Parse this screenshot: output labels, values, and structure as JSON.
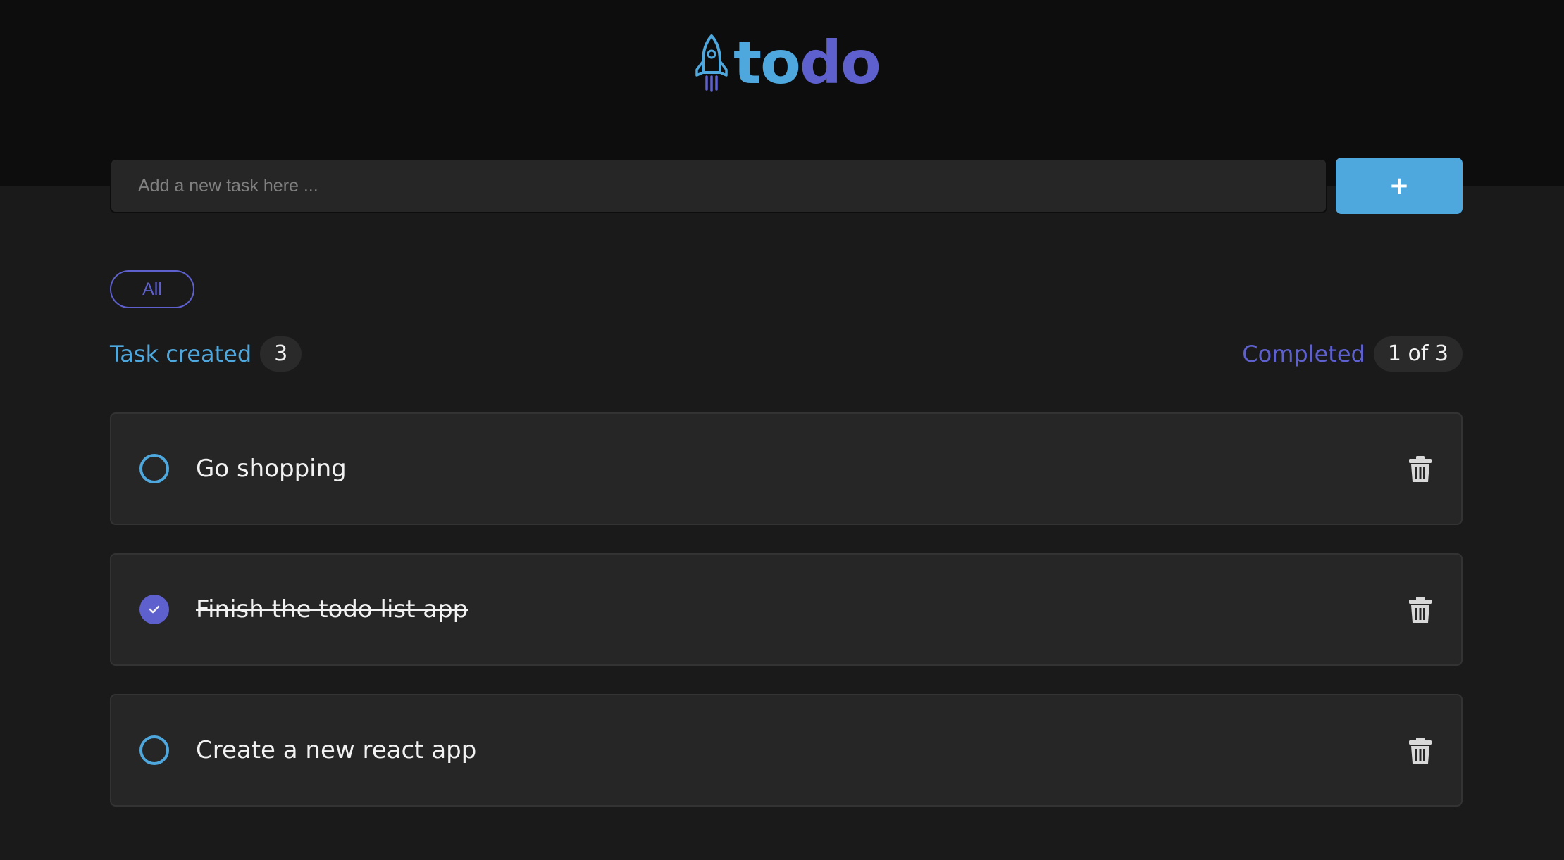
{
  "app": {
    "logo_text_1": "to",
    "logo_text_2": "do",
    "logo_icon": "rocket-icon"
  },
  "input": {
    "placeholder": "Add a new task here ...",
    "value": ""
  },
  "add_button": {
    "label": "+",
    "icon": "plus-icon"
  },
  "filters": [
    {
      "label": "All",
      "selected": true
    }
  ],
  "stats": {
    "created_label": "Task created",
    "created_count": "3",
    "completed_label": "Completed",
    "completed_count": "1 of 3"
  },
  "tasks": [
    {
      "text": "Go shopping",
      "completed": false,
      "delete_icon": "trash-icon"
    },
    {
      "text": "Finish the todo list app",
      "completed": true,
      "delete_icon": "trash-icon"
    },
    {
      "text": "Create a new react app",
      "completed": false,
      "delete_icon": "trash-icon"
    }
  ],
  "colors": {
    "header_bg": "#0d0d0d",
    "page_bg": "#1a1a1a",
    "blue": "#4ea8de",
    "purple": "#5e60ce",
    "card_bg": "#262626",
    "text": "#f2f2f2",
    "icon_gray": "#d9d9d9"
  }
}
